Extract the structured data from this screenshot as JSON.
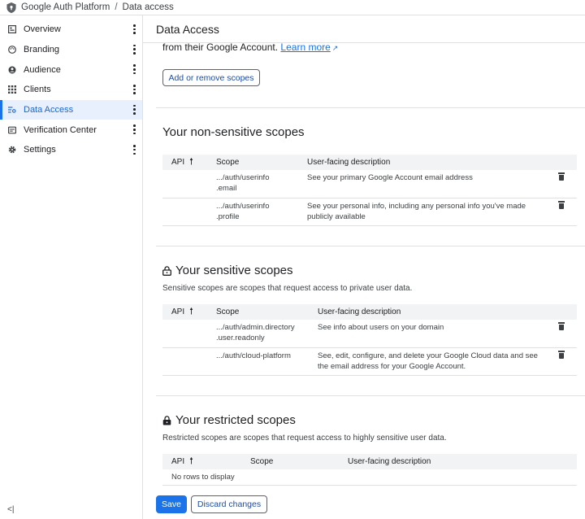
{
  "breadcrumb": {
    "app": "Google Auth Platform",
    "separator": "/",
    "current": "Data access"
  },
  "sidebar": {
    "items": [
      {
        "label": "Overview",
        "icon": "overview-icon"
      },
      {
        "label": "Branding",
        "icon": "palette-icon"
      },
      {
        "label": "Audience",
        "icon": "person-icon"
      },
      {
        "label": "Clients",
        "icon": "grid-icon"
      },
      {
        "label": "Data Access",
        "icon": "data-access-icon",
        "active": true
      },
      {
        "label": "Verification Center",
        "icon": "verification-icon"
      },
      {
        "label": "Settings",
        "icon": "gear-icon"
      }
    ],
    "collapse_label": "<|"
  },
  "main": {
    "title": "Data Access",
    "intro_text": "from their Google Account.",
    "learn_more": "Learn more",
    "add_button": "Add or remove scopes"
  },
  "columns": {
    "api": "API",
    "scope": "Scope",
    "description": "User-facing description"
  },
  "non_sensitive": {
    "title": "Your non-sensitive scopes",
    "rows": [
      {
        "scope_line1": ".../auth/userinfo",
        "scope_line2": ".email",
        "desc_line1": "See your primary Google Account email address",
        "desc_line2": ""
      },
      {
        "scope_line1": ".../auth/userinfo",
        "scope_line2": ".profile",
        "desc_line1": "See your personal info, including any personal info you've made",
        "desc_line2": "publicly available"
      }
    ]
  },
  "sensitive": {
    "title": "Your sensitive scopes",
    "subtitle": "Sensitive scopes are scopes that request access to private user data.",
    "rows": [
      {
        "scope_line1": ".../auth/admin.directory",
        "scope_line2": ".user.readonly",
        "desc_line1": "See info about users on your domain",
        "desc_line2": ""
      },
      {
        "scope_line1": ".../auth/cloud-platform",
        "scope_line2": "",
        "desc_line1": "See, edit, configure, and delete your Google Cloud data and see",
        "desc_line2": "the email address for your Google Account."
      }
    ]
  },
  "restricted": {
    "title": "Your restricted scopes",
    "subtitle": "Restricted scopes are scopes that request access to highly sensitive user data.",
    "empty_text": "No rows to display"
  },
  "footer": {
    "save": "Save",
    "discard": "Discard changes"
  },
  "colors": {
    "accent": "#1a73e8",
    "active_bg": "#e8f0fe",
    "header_bg": "#f1f3f4"
  }
}
